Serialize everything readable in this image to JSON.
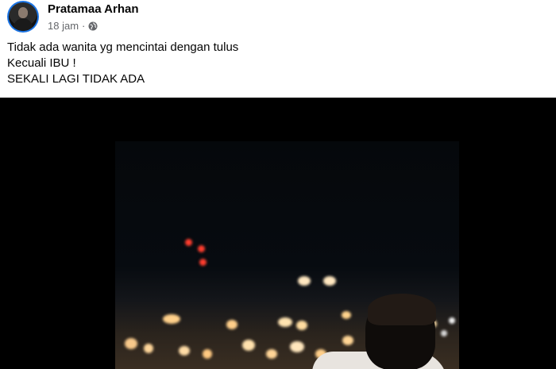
{
  "post": {
    "author": "Pratamaa Arhan",
    "time": "18 jam",
    "separator": "·",
    "privacy_icon": "globe-icon",
    "lines": [
      "Tidak ada wanita yg mencintai dengan tulus",
      "Kecuali IBU !",
      "SEKALI LAGI TIDAK ADA"
    ]
  },
  "colors": {
    "avatar_ring": "#1b74e4",
    "text": "#050505",
    "meta": "#65676b",
    "media_background": "#000000"
  }
}
